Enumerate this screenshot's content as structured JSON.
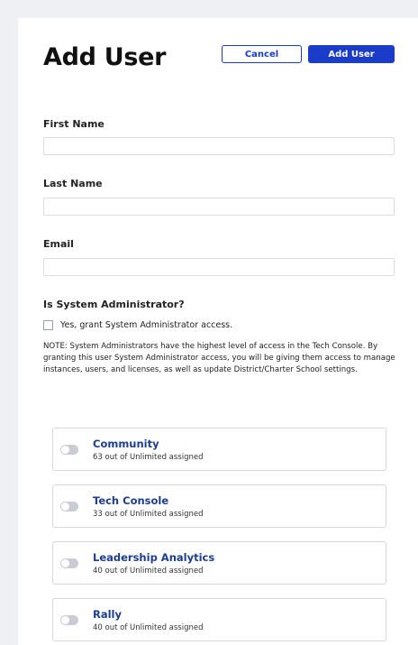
{
  "header": {
    "title": "Add User",
    "cancel_label": "Cancel",
    "add_label": "Add User"
  },
  "form": {
    "first_name": {
      "label": "First Name",
      "value": ""
    },
    "last_name": {
      "label": "Last Name",
      "value": ""
    },
    "email": {
      "label": "Email",
      "value": ""
    },
    "sysadmin": {
      "label": "Is System Administrator?",
      "checkbox_label": "Yes, grant System Administrator access.",
      "checked": false,
      "note": "NOTE: System Administrators have the highest level of access in the Tech Console. By granting this user System Administrator access, you will be giving them access to manage instances, users, and licenses, as well as update District/Charter School settings."
    }
  },
  "licenses": [
    {
      "name": "Community",
      "assigned": "63 out of Unlimited assigned",
      "enabled": false
    },
    {
      "name": "Tech Console",
      "assigned": "33 out of Unlimited assigned",
      "enabled": false
    },
    {
      "name": "Leadership Analytics",
      "assigned": "40 out of Unlimited assigned",
      "enabled": false
    },
    {
      "name": "Rally",
      "assigned": "40 out of Unlimited assigned",
      "enabled": false
    }
  ],
  "colors": {
    "accent": "#1b3cc8",
    "license_name": "#1d3d8f",
    "toggle_off": "#c9cdd3",
    "page_bg": "#eef0f4"
  }
}
